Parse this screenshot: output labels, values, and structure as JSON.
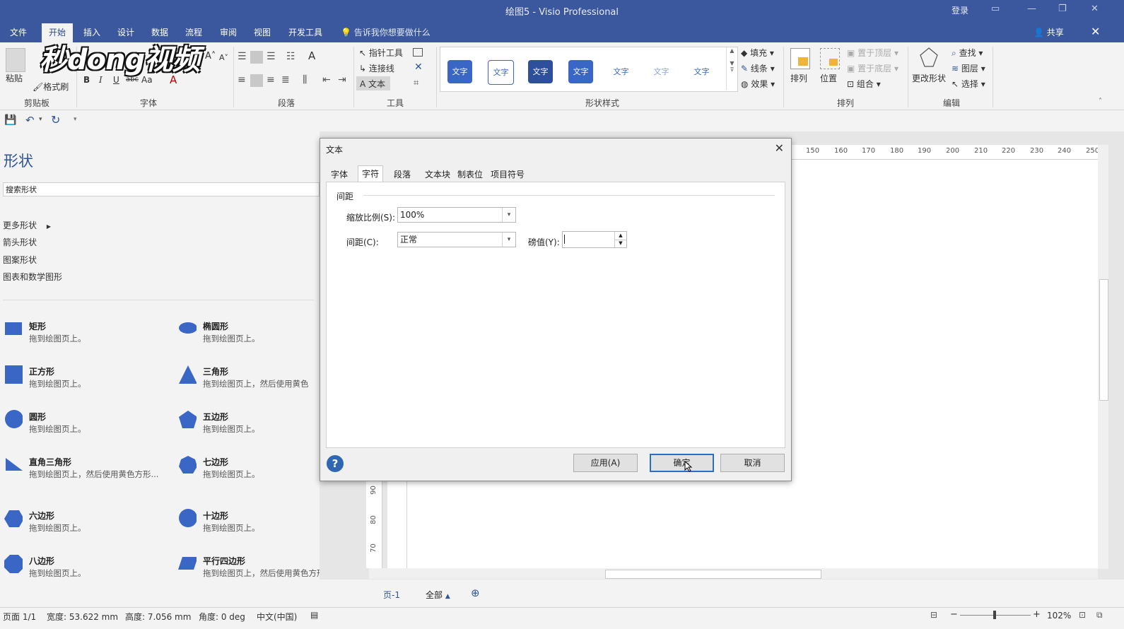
{
  "window": {
    "title": "绘图5  -  Visio Professional",
    "login": "登录"
  },
  "menu": {
    "tabs": [
      "文件",
      "开始",
      "插入",
      "设计",
      "数据",
      "流程",
      "审阅",
      "视图",
      "开发工具"
    ],
    "active": "开始",
    "tell_me": "告诉我你想要做什么",
    "share": "共享"
  },
  "ribbon": {
    "clipboard": {
      "label": "剪贴板",
      "paste": "粘贴",
      "format_painter": "格式刷"
    },
    "font": {
      "label": "字体",
      "bold": "B",
      "italic": "I",
      "underline": "U",
      "strike": "abc",
      "case": "Aa",
      "color": "A"
    },
    "paragraph": {
      "label": "段落"
    },
    "tools": {
      "label": "工具",
      "pointer": "指针工具",
      "connector": "连接线",
      "text": "文本"
    },
    "shape_styles": {
      "label": "形状样式",
      "box_text": "文字",
      "fill": "填充",
      "line": "线条",
      "effect": "效果"
    },
    "arrange": {
      "label": "排列",
      "arrange_btn": "排列",
      "position": "位置",
      "bring_front": "置于顶层",
      "send_back": "置于底层",
      "group": "组合"
    },
    "edit": {
      "label": "编辑",
      "change_shape": "更改形状",
      "find": "查找",
      "layers": "图层",
      "select": "选择"
    }
  },
  "watermark": "秒dong视频",
  "shapes_panel": {
    "title": "形状",
    "search_placeholder": "搜索形状",
    "categories": [
      "更多形状",
      "箭头形状",
      "图案形状",
      "图表和数学图形"
    ],
    "items": [
      {
        "name": "矩形",
        "desc": "拖到绘图页上。",
        "icon": "rectangle-icon"
      },
      {
        "name": "椭圆形",
        "desc": "拖到绘图页上。",
        "icon": "ellipse-icon"
      },
      {
        "name": "正方形",
        "desc": "拖到绘图页上。",
        "icon": "square-icon"
      },
      {
        "name": "三角形",
        "desc": "拖到绘图页上，然后使用黄色",
        "icon": "triangle-icon"
      },
      {
        "name": "圆形",
        "desc": "拖到绘图页上。",
        "icon": "circle-icon"
      },
      {
        "name": "五边形",
        "desc": "拖到绘图页上。",
        "icon": "pentagon-icon"
      },
      {
        "name": "直角三角形",
        "desc": "拖到绘图页上，然后使用黄色方形...",
        "icon": "right-triangle-icon"
      },
      {
        "name": "七边形",
        "desc": "拖到绘图页上。",
        "icon": "heptagon-icon"
      },
      {
        "name": "六边形",
        "desc": "拖到绘图页上。",
        "icon": "hexagon-icon"
      },
      {
        "name": "十边形",
        "desc": "拖到绘图页上。",
        "icon": "decagon-icon"
      },
      {
        "name": "八边形",
        "desc": "拖到绘图页上。",
        "icon": "octagon-icon"
      },
      {
        "name": "平行四边形",
        "desc": "拖到绘图页上，然后使用黄色方形...",
        "icon": "parallelogram-icon"
      }
    ]
  },
  "ruler": {
    "top": [
      "150",
      "160",
      "170",
      "180",
      "190",
      "200",
      "210",
      "220",
      "230",
      "240",
      "250"
    ],
    "left": [
      "90",
      "80",
      "70"
    ]
  },
  "dialog": {
    "title": "文本",
    "tabs": [
      "字体",
      "字符",
      "段落",
      "文本块",
      "制表位",
      "项目符号"
    ],
    "active_tab": "字符",
    "section": "间距",
    "scale_label": "缩放比例(S):",
    "scale_value": "100%",
    "spacing_label": "间距(C):",
    "spacing_value": "正常",
    "pounds_label": "磅值(Y):",
    "pounds_value": "",
    "apply": "应用(A)",
    "ok": "确定",
    "cancel": "取消",
    "help": "?"
  },
  "page_tabs": {
    "page": "页-1",
    "all": "全部"
  },
  "status": {
    "page": "页面 1/1",
    "width": "宽度: 53.622 mm",
    "height": "高度: 7.056 mm",
    "angle": "角度: 0 deg",
    "lang": "中文(中国)",
    "zoom": "102%"
  },
  "colors": {
    "accent": "#3b579d",
    "shape_blue": "#3a66c6",
    "ok_border": "#2b6fc4"
  }
}
